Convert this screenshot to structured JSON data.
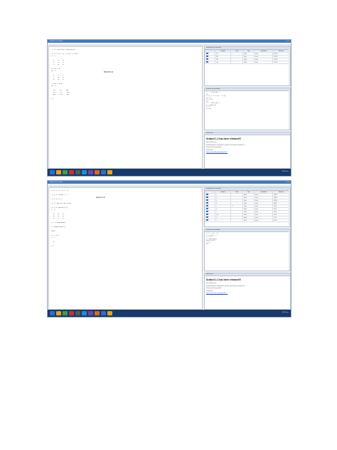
{
  "screens": [
    {
      "window_title": "Scilab 6.1.1 Console",
      "menu": [
        "Archivo",
        "Editar",
        "Control",
        "Aplicaciones",
        "?"
      ],
      "console_lines": [
        "--> // Matrices aleatorias",
        "",
        "--> M = [1 2 3; 4 5 6; 7 8 9]",
        " M  =",
        "",
        "   1.   2.   3.",
        "   4.   5.   6.",
        "   7.   8.   9.",
        "",
        "--> M1 = M'",
        " M1  =",
        "",
        "   1.   4.   7.",
        "   2.   5.   8.",
        "   3.   6.   9.",
        "",
        "--> M2 = M*M1",
        " M2  =",
        "",
        "   14.    32.    50.",
        "   32.    77.    122.",
        "   50.    122.   194.",
        "",
        "-->"
      ],
      "punto_label": "PUNTO 3",
      "variables_title": "Explorador de variables",
      "variables_header": [
        "Nombre",
        "Valor",
        "Tipo",
        "Visibilidad",
        "Memoria"
      ],
      "variables": [
        [
          "M",
          "",
          "Real",
          "local",
          "216 B"
        ],
        [
          "M1",
          "",
          "Real",
          "local",
          "216 B"
        ],
        [
          "M2",
          "",
          "Real",
          "local",
          "216 B"
        ],
        [
          "ans",
          "",
          "Real",
          "local",
          "216 B"
        ]
      ],
      "history_title": "Historial de comandos",
      "history_lines": [
        "// -- 12/07/2021 --",
        "clc",
        "M = [1 2 3; 4 5 6; 7 8 9]",
        "M1 = M'",
        "M2 = M*M1",
        "clc",
        "// -- 13/07/2021 --",
        "A = rand(3,3)",
        "B = A'",
        "C = A*B"
      ],
      "news_title": "Scilab 6.1.1 has been released!!!"
    },
    {
      "window_title": "Scilab 6.1.1 Console",
      "menu": [
        "Archivo",
        "Editar",
        "Control",
        "Aplicaciones",
        "?"
      ],
      "console_lines": [
        "--> x = 1 : 0.1 : 5",
        "",
        "--> y = sin(x) + 2",
        "",
        "--> z = x.^2",
        "",
        "--> // matriz de ceros",
        "",
        "--> Z = zeros(3,3)",
        " Z  =",
        "",
        "   0.   0.   0.",
        "   0.   0.   0.",
        "   0.   0.   0.",
        "",
        "--> // Funciones",
        "",
        "--> disp(\"hola\")",
        "",
        " hola",
        "",
        "--> a = 5",
        " a  =",
        "",
        "   5.",
        "",
        "-->"
      ],
      "punto_label": "punto 4.3",
      "variables_title": "Explorador de variables",
      "variables_header": [
        "Nombre",
        "Valor",
        "Tipo",
        "Visibilidad",
        "Memoria"
      ],
      "variables": [
        [
          "x",
          "",
          "Real",
          "local",
          "344 B"
        ],
        [
          "y",
          "",
          "Real",
          "local",
          "344 B"
        ],
        [
          "z",
          "",
          "Real",
          "local",
          "344 B"
        ],
        [
          "Z",
          "",
          "Real",
          "local",
          "88 B"
        ],
        [
          "a",
          "5",
          "Real",
          "local",
          "16 B"
        ],
        [
          "b",
          "",
          "Real",
          "local",
          "16 B"
        ],
        [
          "c",
          "",
          "Real",
          "local",
          "16 B"
        ],
        [
          "ans",
          "",
          "Real",
          "local",
          "16 B"
        ],
        [
          "d",
          "",
          "Real",
          "local",
          "16 B"
        ],
        [
          "e",
          "",
          "Real",
          "local",
          "16 B"
        ]
      ],
      "history_title": "Historial de comandos",
      "history_lines": [
        "x = 1 : 0.1 : 5",
        "y = sin(x) + 2",
        "z = x.^2",
        "Z = zeros(3,3)",
        "disp(\"hola\")",
        "a = 5",
        "clc"
      ],
      "news_title": "Scilab 6.1.1 has been released!!!"
    }
  ],
  "news_body": [
    "Dear Scilab users,",
    "Scilab Enterprises is pleased to announce the release of Scilab 6.1.1.",
    "Thank you for using Scilab!",
    "Scilab team"
  ],
  "news_link": "https://www.scilab.org/download/6.1.1",
  "taskbar": {
    "clock": "11:15 a.m.",
    "icon_colors": [
      "#2f6fc9",
      "#e8a318",
      "#3aa24a",
      "#c8332b",
      "#5a5a5a",
      "#1d8fd1",
      "#7b3fb2",
      "#d66c1a",
      "#2f6fc9",
      "#e8a318"
    ]
  }
}
